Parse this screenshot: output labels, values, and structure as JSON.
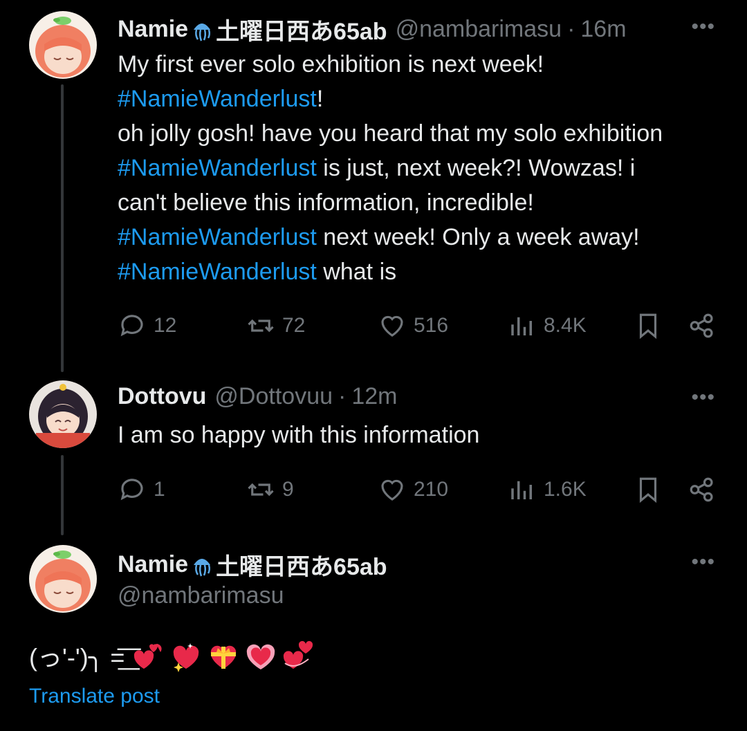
{
  "post1": {
    "name": "Namie",
    "name_suffix": "土曜日西あ65ab",
    "handle": "@nambarimasu",
    "separator": "·",
    "time": "16m",
    "more": "•••",
    "lines": [
      {
        "pre": "My first ever solo exhibition is next week!",
        "tag": "",
        "post": ""
      },
      {
        "pre": "",
        "tag": "#NamieWanderlust",
        "post": "!"
      },
      {
        "pre": "oh jolly gosh! have you heard that my solo exhibition",
        "tag": "",
        "post": ""
      },
      {
        "pre": "",
        "tag": "#NamieWanderlust",
        "post": " is just, next week?! Wowzas! i"
      },
      {
        "pre": "can't believe this information, incredible!",
        "tag": "",
        "post": ""
      },
      {
        "pre": "",
        "tag": "#NamieWanderlust",
        "post": " next week! Only a week away!"
      },
      {
        "pre": "",
        "tag": "#NamieWanderlust",
        "post": " what is"
      }
    ],
    "stats": {
      "replies": "12",
      "reposts": "72",
      "likes": "516",
      "views": "8.4K"
    }
  },
  "post2": {
    "name": "Dottovu",
    "handle": "@Dottovuu",
    "separator": "·",
    "time": "12m",
    "more": "•••",
    "text": "I am so happy with this information",
    "stats": {
      "replies": "1",
      "reposts": "9",
      "likes": "210",
      "views": "1.6K"
    }
  },
  "post3": {
    "name": "Namie",
    "name_suffix": "土曜日西あ65ab",
    "handle": "@nambarimasu",
    "more": "•••",
    "kaomoji": "(っ'-')╮ =͟͟͞͞",
    "emojis": [
      "heart-with-arrow",
      "sparkling-heart",
      "heart-with-ribbon",
      "growing-heart",
      "two-hearts"
    ],
    "translate": "Translate post"
  },
  "colors": {
    "background": "#000000",
    "text": "#e7e9ea",
    "muted": "#71767b",
    "link": "#1d9bf0",
    "thread": "#333639"
  }
}
